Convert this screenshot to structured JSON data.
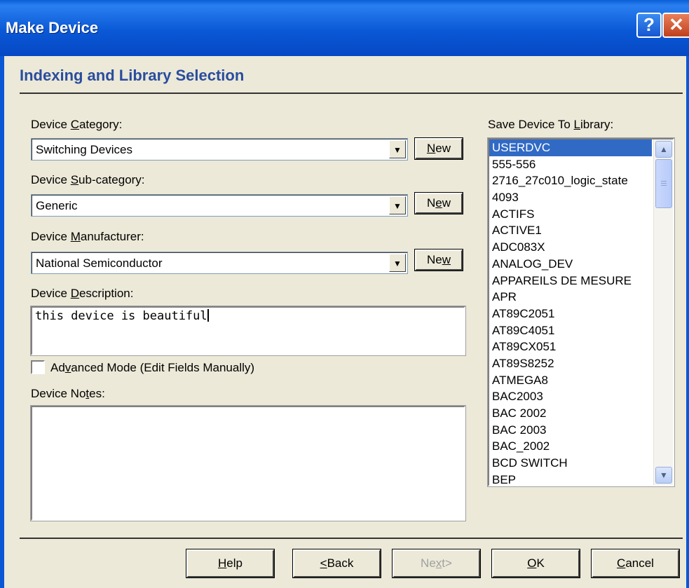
{
  "window": {
    "title": "Make Device",
    "help_glyph": "?",
    "close_glyph": "✕"
  },
  "section": {
    "title": "Indexing and Library Selection"
  },
  "category": {
    "label_pre": "Device ",
    "label_key": "C",
    "label_post": "ategory:",
    "value": "Switching Devices",
    "new_pre": "",
    "new_key": "N",
    "new_post": "ew"
  },
  "subcategory": {
    "label_pre": "Device ",
    "label_key": "S",
    "label_post": "ub-category:",
    "value": "Generic",
    "new_pre": "N",
    "new_key": "e",
    "new_post": "w"
  },
  "manufacturer": {
    "label_pre": "Device ",
    "label_key": "M",
    "label_post": "anufacturer:",
    "value": "National Semiconductor",
    "new_pre": "Ne",
    "new_key": "w",
    "new_post": ""
  },
  "description": {
    "label_pre": "Device ",
    "label_key": "D",
    "label_post": "escription:",
    "value": "this device is beautiful"
  },
  "advanced": {
    "label_pre": "Ad",
    "label_key": "v",
    "label_post": "anced Mode (Edit Fields Manually)",
    "checked": false
  },
  "notes": {
    "label_pre": "Device No",
    "label_key": "t",
    "label_post": "es:",
    "value": ""
  },
  "library": {
    "label_pre": "Save Device To ",
    "label_key": "L",
    "label_post": "ibrary:",
    "items": [
      "USERDVC",
      "555-556",
      "2716_27c010_logic_state",
      "4093",
      "ACTIFS",
      "ACTIVE1",
      "ADC083X",
      "ANALOG_DEV",
      "APPAREILS DE MESURE",
      "APR",
      "AT89C2051",
      "AT89C4051",
      "AT89CX051",
      "AT89S8252",
      "ATMEGA8",
      "BAC2003",
      "BAC 2002",
      "BAC 2003",
      "BAC_2002",
      "BCD SWITCH",
      "BEP"
    ],
    "selected": "USERDVC"
  },
  "footer": {
    "help": {
      "key": "H",
      "post": "elp"
    },
    "back": {
      "pre": "",
      "key": "<",
      "post": "Back"
    },
    "next": {
      "pre": "Ne",
      "key": "x",
      "post": "t>"
    },
    "ok": {
      "key": "O",
      "post": "K"
    },
    "cancel": {
      "key": "C",
      "post": "ancel"
    }
  },
  "colors": {
    "titlebar": "#0a58d6",
    "section_title": "#2a4d9e",
    "selection": "#316ac5",
    "dialog_bg": "#ece9d8"
  }
}
